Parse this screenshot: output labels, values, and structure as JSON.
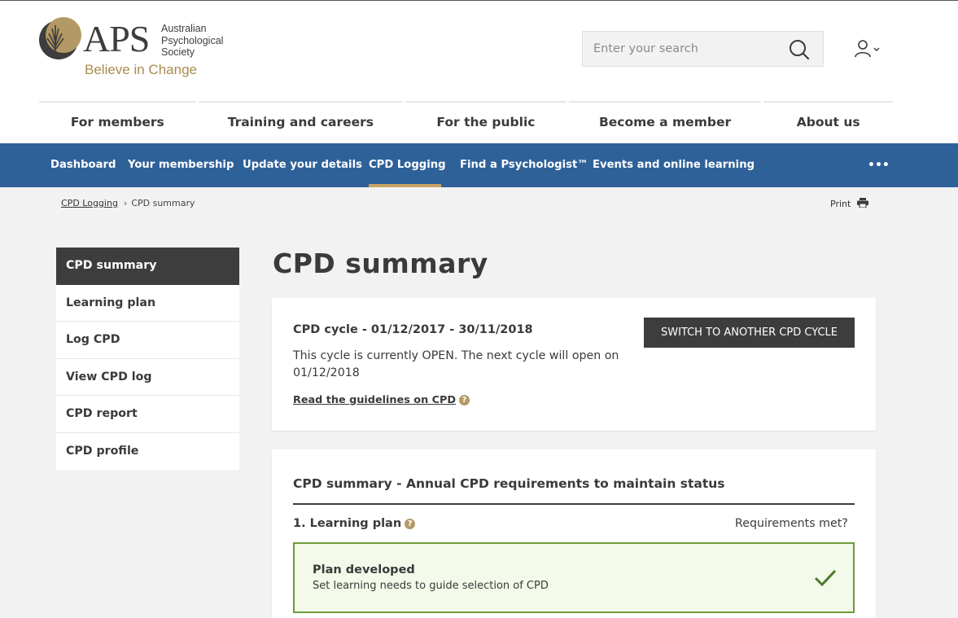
{
  "brand": {
    "name": "APS",
    "society_lines": [
      "Australian",
      "Psychological",
      "Society"
    ],
    "tagline": "Believe in Change",
    "gold": "#a98a4f"
  },
  "search": {
    "placeholder": "Enter your search",
    "icon": "search-icon"
  },
  "user_menu": {
    "icon": "user-icon",
    "dropdown_icon": "chevron-down-icon"
  },
  "main_nav": [
    {
      "label": "For members"
    },
    {
      "label": "Training and careers"
    },
    {
      "label": "For the public"
    },
    {
      "label": "Become a member"
    },
    {
      "label": "About us"
    }
  ],
  "sub_nav": {
    "color": "#2f6199",
    "accent": "#c9a464",
    "items": [
      {
        "label": "Dashboard"
      },
      {
        "label": "Your membership"
      },
      {
        "label": "Update your details"
      },
      {
        "label": "CPD Logging",
        "active": true
      },
      {
        "label": "Find a Psychologist™"
      },
      {
        "label": "Events and online learning"
      }
    ],
    "more_label": "•••"
  },
  "breadcrumb": {
    "parent": "CPD Logging",
    "separator": "›",
    "current": "CPD summary"
  },
  "print": {
    "label": "Print",
    "icon": "printer-icon"
  },
  "sidebar": {
    "items": [
      {
        "label": "CPD summary",
        "active": true
      },
      {
        "label": "Learning plan"
      },
      {
        "label": "Log CPD"
      },
      {
        "label": "View CPD log"
      },
      {
        "label": "CPD report"
      },
      {
        "label": "CPD profile"
      }
    ]
  },
  "page_title": "CPD summary",
  "cycle": {
    "title": "CPD cycle - 01/12/2017 - 30/11/2018",
    "description": "This cycle is currently OPEN. The next cycle will open on 01/12/2018",
    "guidelines_link": "Read the guidelines on CPD",
    "switch_button": "SWITCH TO ANOTHER CPD CYCLE",
    "help_glyph": "?"
  },
  "summary": {
    "title": "CPD summary - Annual CPD requirements to maintain status",
    "learning_plan_label": "1. Learning plan",
    "requirements_header": "Requirements met?",
    "plan": {
      "title": "Plan developed",
      "description": "Set learning needs to guide selection of CPD",
      "status_icon": "checkmark-icon",
      "status_color": "#4a7a2c"
    }
  }
}
